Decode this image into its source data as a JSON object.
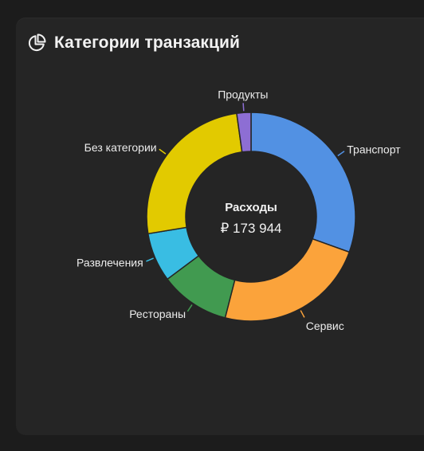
{
  "card": {
    "title": "Категории транзакций",
    "icon": "pie-chart-icon"
  },
  "chart_data": {
    "type": "pie",
    "variant": "donut",
    "center_label": "Расходы",
    "center_value": "₽ 173 944",
    "slices": [
      {
        "label": "Транспорт",
        "value": 30.5,
        "color": "#5291e3"
      },
      {
        "label": "Сервис",
        "value": 23.5,
        "color": "#fba33b"
      },
      {
        "label": "Рестораны",
        "value": 10.8,
        "color": "#419a50"
      },
      {
        "label": "Развлечения",
        "value": 7.6,
        "color": "#39bde3"
      },
      {
        "label": "Без категории",
        "value": 25.4,
        "color": "#e2ca00"
      },
      {
        "label": "Продукты",
        "value": 2.2,
        "color": "#8d6ed4"
      }
    ],
    "legend": "none"
  }
}
